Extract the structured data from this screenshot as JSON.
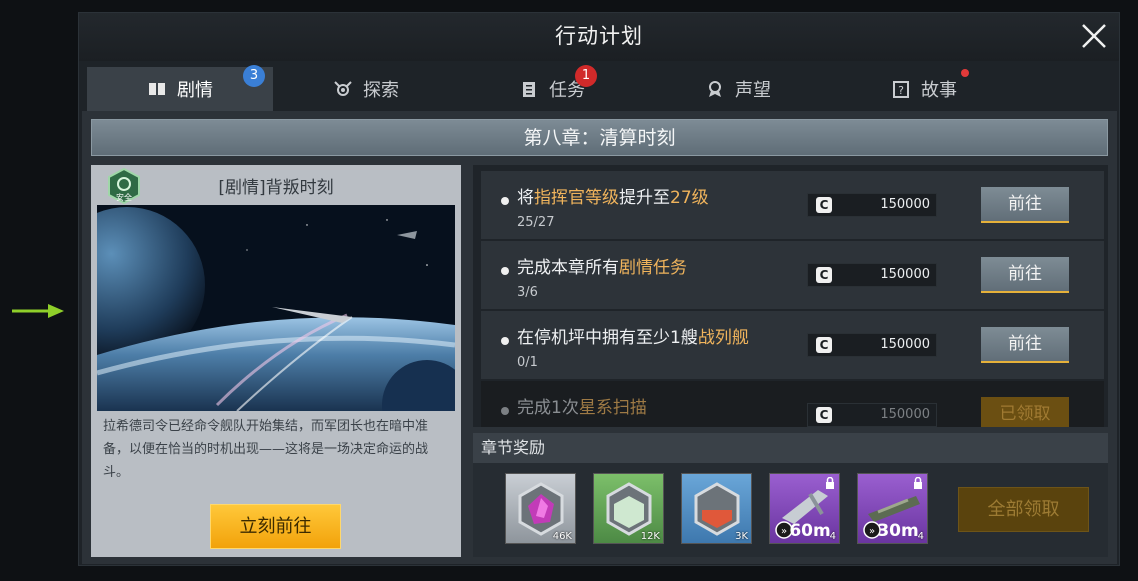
{
  "window": {
    "title": "行动计划"
  },
  "tabs": [
    {
      "label": "剧情",
      "icon": "book-icon",
      "badge": "3"
    },
    {
      "label": "探索",
      "icon": "explore-icon",
      "badge": ""
    },
    {
      "label": "任务",
      "icon": "clipboard-icon",
      "badge": "1"
    },
    {
      "label": "声望",
      "icon": "medal-icon",
      "badge": ""
    },
    {
      "label": "故事",
      "icon": "story-icon",
      "badge": ""
    }
  ],
  "chapter": {
    "title": "第八章：清算时刻"
  },
  "story": {
    "safe_label": "安全",
    "title": "[剧情]背叛时刻",
    "description": "拉希德司令已经命令舰队开始集结，而军团长也在暗中准备，以便在恰当的时机出现——这将是一场决定命运的战斗。",
    "go_button": "立刻前往"
  },
  "tasks": [
    {
      "pre": "将",
      "hl": "指挥官等级",
      "mid": "提升至",
      "hl2": "27级",
      "post": "",
      "progress": "25/27",
      "reward_icon": "C",
      "reward": "150000",
      "button": "前往"
    },
    {
      "pre": "完成本章所有",
      "hl": "剧情任务",
      "mid": "",
      "hl2": "",
      "post": "",
      "progress": "3/6",
      "reward_icon": "C",
      "reward": "150000",
      "button": "前往"
    },
    {
      "pre": "在停机坪中拥有至少1艘",
      "hl": "战列舰",
      "mid": "",
      "hl2": "",
      "post": "",
      "progress": "0/1",
      "reward_icon": "C",
      "reward": "150000",
      "button": "前往"
    },
    {
      "pre": "完成1次",
      "hl": "星系扫描",
      "mid": "",
      "hl2": "",
      "post": "",
      "progress": "",
      "reward_icon": "C",
      "reward": "150000",
      "button": "已领取"
    }
  ],
  "chapter_rewards": {
    "header": "章节奖励",
    "items": [
      {
        "name": "purple-crystal-icon",
        "count": "46K"
      },
      {
        "name": "green-metal-icon",
        "count": "12K"
      },
      {
        "name": "red-gas-icon",
        "count": "3K"
      },
      {
        "name": "speedup-icon",
        "label": "60m",
        "count": "4"
      },
      {
        "name": "speedup-icon",
        "label": "30m",
        "count": "4"
      }
    ],
    "claim_all": "全部领取"
  },
  "colors": {
    "accent_yellow": "#f2a20a",
    "highlight": "#f0b45c",
    "badge_blue": "#3a7fd6",
    "badge_red": "#d12a2a"
  }
}
